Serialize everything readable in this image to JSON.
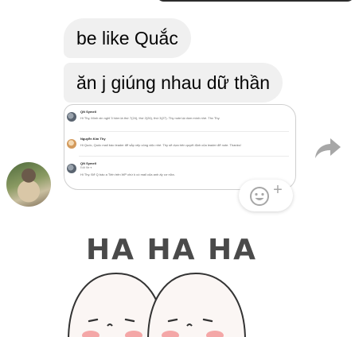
{
  "messages": [
    {
      "text": "be like Quắc"
    },
    {
      "text": "ăn j giúng nhau dữ thần"
    }
  ],
  "shared_card": {
    "rows": [
      {
        "name": "QN Symell",
        "text": "Hi Thy, Mình xin nghỉ 3 hôm là thứ 7(24), thứ 2(26), thứ 3(27). Thy note lại dùm mình nhé. Thx Thy."
      },
      {
        "name": "Nguyễn Kim Thy",
        "text": "Hi Quốc, Quốc mail báo leader để sắp xếp công việc nhé. Thy sẽ dựa trên quyết định của leader để note. Thanks!"
      },
      {
        "name": "QN Symell",
        "sub": "Edit file ▾",
        "text": "Hi Thy. Để Q báo a Tiến trên WP chứ k có mail của anh ấy cơ nữa."
      }
    ]
  },
  "reaction_plus": "+",
  "sticker": {
    "text": "HA HA HA"
  },
  "icons": {
    "avatar": "user-avatar",
    "forward": "forward-arrow-icon",
    "reaction": "smiley-add-icon"
  },
  "colors": {
    "bubble_bg": "#f0f0f0",
    "icon_gray": "#a7a7a7"
  }
}
